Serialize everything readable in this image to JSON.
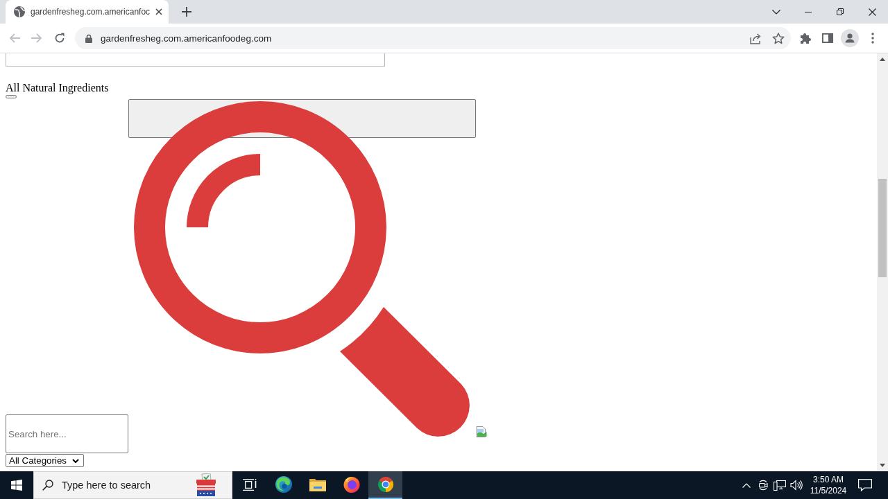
{
  "browser": {
    "tabs": [
      {
        "title": "gardenfresheg.com.americanfoc",
        "selected": true
      }
    ],
    "navigation": {
      "back": {
        "disabled": true
      },
      "forward": {
        "disabled": true
      }
    },
    "address_bar": {
      "url": "gardenfresheg.com.americanfoodeg.com"
    }
  },
  "page": {
    "heading": "All Natural Ingredients",
    "search_field": {
      "placeholder": "Search here..."
    },
    "category_select": {
      "value": "All Categories"
    }
  },
  "taskbar": {
    "search": {
      "placeholder": "Type here to search"
    },
    "apps": [
      {
        "kind": "taskview",
        "selected": false
      },
      {
        "kind": "edge",
        "selected": false
      },
      {
        "kind": "explorer",
        "selected": false
      },
      {
        "kind": "firefox",
        "selected": false
      },
      {
        "kind": "chrome",
        "selected": true
      }
    ],
    "clock": {
      "time": "3:50 AM",
      "date": "11/5/2024"
    }
  }
}
